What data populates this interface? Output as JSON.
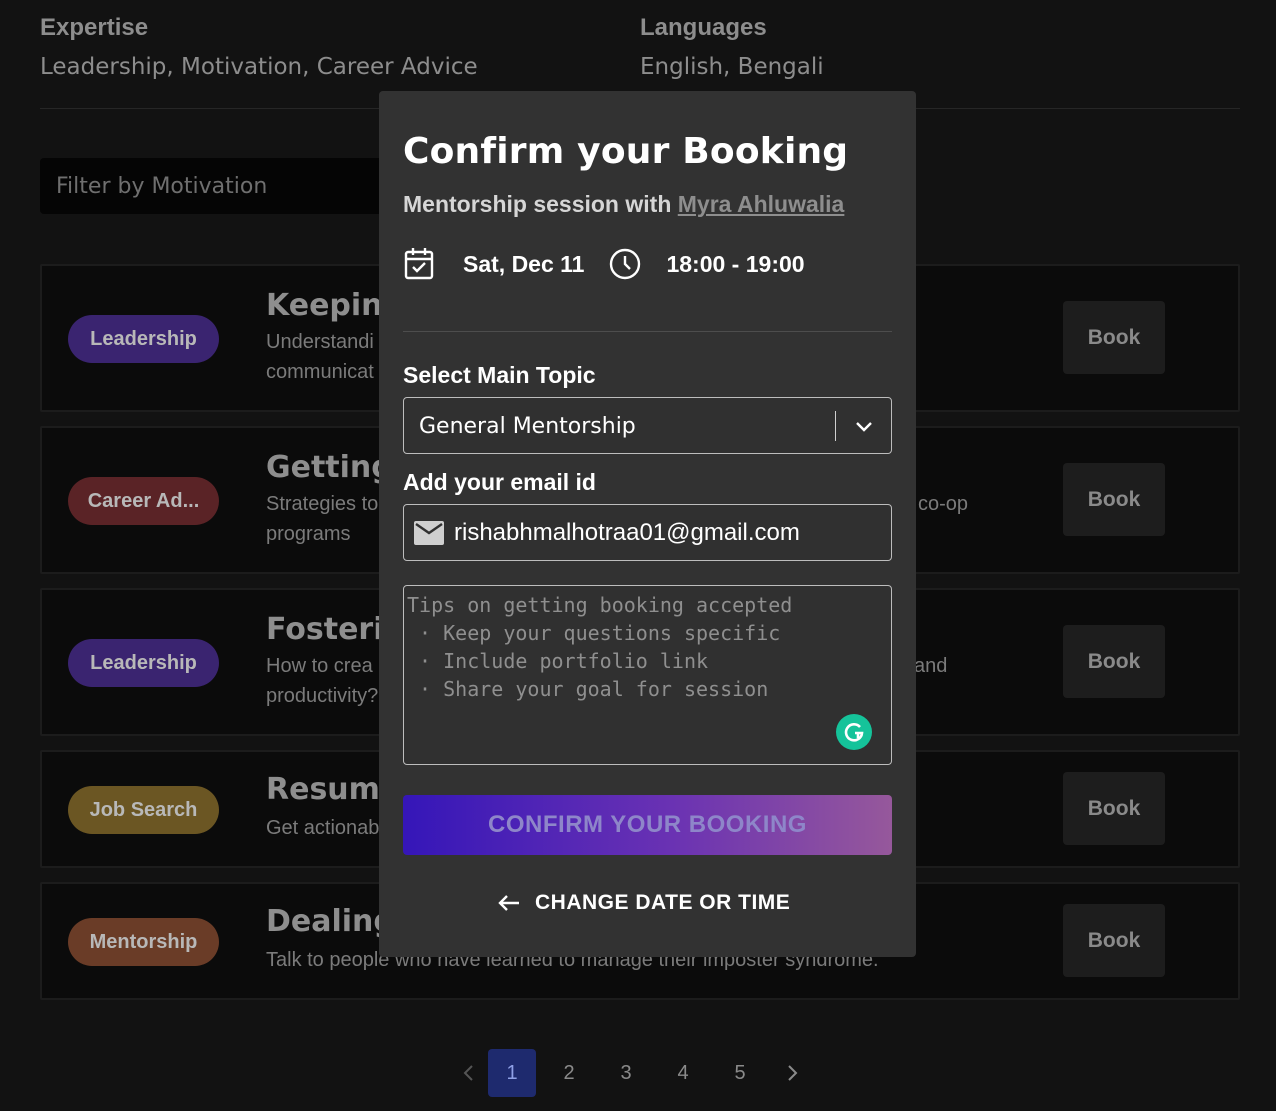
{
  "profile": {
    "expertise_label": "Expertise",
    "expertise_value": "Leadership, Motivation, Career Advice",
    "languages_label": "Languages",
    "languages_value": "English, Bengali"
  },
  "filter": {
    "placeholder": "Filter by Motivation"
  },
  "sessions": [
    {
      "tag": "Leadership",
      "tag_color": "#3a2470",
      "title": "Keepin",
      "desc_lines": [
        "Understandi",
        "communicat"
      ],
      "book": "Book"
    },
    {
      "tag": "Career Ad...",
      "tag_color": "#5a2326",
      "title": "Getting",
      "desc_lines": [
        "Strategies to",
        "programs"
      ],
      "desc_right": "co-op",
      "book": "Book"
    },
    {
      "tag": "Leadership",
      "tag_color": "#3a2470",
      "title": "Fosteri",
      "desc_lines": [
        "How to crea",
        "productivity?"
      ],
      "desc_right": "and",
      "book": "Book"
    },
    {
      "tag": "Job Search",
      "tag_color": "#6b5623",
      "title": "Resum",
      "desc_lines": [
        "Get actionab"
      ],
      "book": "Book"
    },
    {
      "tag": "Mentorship",
      "tag_color": "#6a3c27",
      "title": "Dealing",
      "desc_lines": [
        "Talk to people who have learned to manage their imposter syndrome."
      ],
      "book": "Book"
    }
  ],
  "pagination": {
    "pages": [
      "1",
      "2",
      "3",
      "4",
      "5"
    ],
    "current": "1"
  },
  "modal": {
    "title": "Confirm your Booking",
    "subtitle_prefix": "Mentorship session with",
    "mentor_name": "Myra Ahluwalia",
    "date": "Sat, Dec 11",
    "time": "18:00 - 19:00",
    "topic_label": "Select Main Topic",
    "topic_value": "General Mentorship",
    "email_label": "Add your email id",
    "email_value": "rishabhmalhotraa01@gmail.com",
    "notes_placeholder": "Tips on getting booking accepted\n · Keep your questions specific\n · Include portfolio link\n · Share your goal for session",
    "confirm_label": "CONFIRM YOUR BOOKING",
    "change_label": "CHANGE DATE OR TIME"
  },
  "icons": {
    "calendar": "calendar-check-icon",
    "clock": "clock-icon",
    "dropdown": "chevron-down-icon",
    "email": "mail-icon",
    "grammarly": "grammarly-icon",
    "back": "arrow-left-icon",
    "prev": "chevron-left-icon",
    "next": "chevron-right-icon"
  },
  "colors": {
    "accent_gradient_start": "#3516b8",
    "accent_gradient_end": "#96589b",
    "grammarly": "#15c39a",
    "active_page": "#1e2a6e"
  }
}
